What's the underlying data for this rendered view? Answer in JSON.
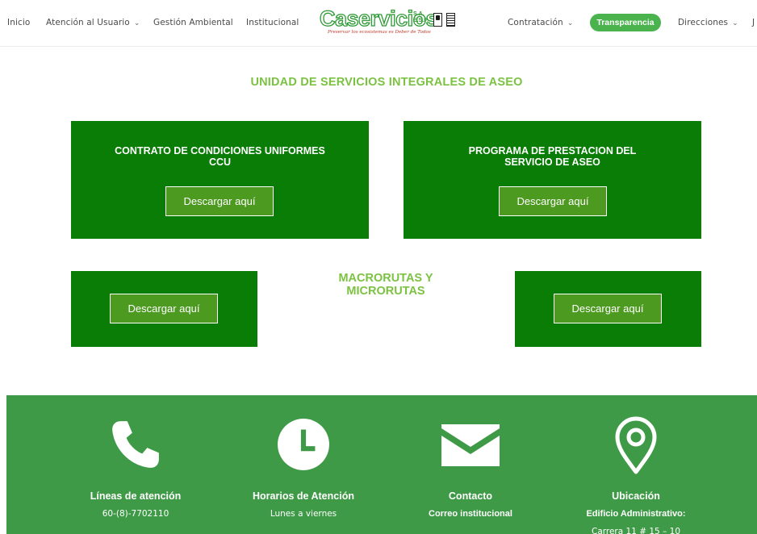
{
  "nav": {
    "inicio": "Inicio",
    "atencion": "Atención al Usuario",
    "gestion": "Gestión Ambiental",
    "institucional": "Institucional",
    "contratacion": "Contratación",
    "transparencia": "Transparencia",
    "direcciones": "Direcciones",
    "cutoff": "J"
  },
  "logo": {
    "name": "Caservicios",
    "suffix_top": "S.A.",
    "suffix_bottom": "E.S.P.",
    "tagline": "Preservar los ecosistemas es Deber de Todos"
  },
  "page_heading": "UNIDAD DE SERVICIOS INTEGRALES DE ASEO",
  "cards": [
    {
      "title_line1": "CONTRATO DE CONDICIONES UNIFORMES",
      "title_line2": "CCU",
      "button": "Descargar aquí"
    },
    {
      "title_line1": "PROGRAMA DE PRESTACION DEL",
      "title_line2": "SERVICIO DE ASEO",
      "button": "Descargar aquí"
    },
    {
      "button": "Descargar aquí"
    },
    {
      "button": "Descargar aquí"
    }
  ],
  "mid_heading": {
    "line1": "MACRORUTAS Y",
    "line2": "MICRORUTAS"
  },
  "footer": {
    "lineas": {
      "title": "Líneas de atención",
      "text": "60-(8)-7702110",
      "icon": "phone-icon"
    },
    "horarios": {
      "title": "Horarios de Atención",
      "text": "Lunes a viernes",
      "icon": "clock-icon"
    },
    "contacto": {
      "title": "Contacto",
      "text": "Correo institucional",
      "icon": "envelope-icon"
    },
    "ubicacion": {
      "title": "Ubicación",
      "text": "Edificio Administrativo:",
      "text2": "Carrera 11 # 15 – 10",
      "icon": "map-pin-icon"
    }
  },
  "colors": {
    "card_green": "#0a7d06",
    "heading_green": "#7cc242",
    "button_green": "#4d9a21",
    "footer_green": "#3e9a46",
    "pill_green": "#4bb34e"
  }
}
